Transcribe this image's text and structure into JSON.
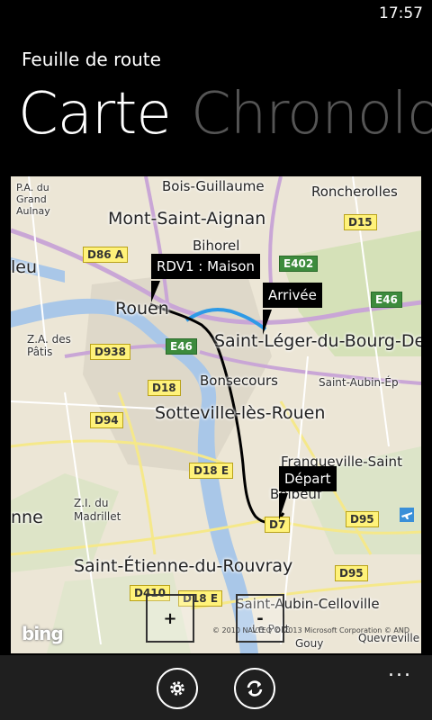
{
  "status": {
    "time": "17:57"
  },
  "app": {
    "title": "Feuille de route"
  },
  "pivot": {
    "active": "Carte",
    "next": "Chronologie"
  },
  "map": {
    "places": {
      "bois_guillaume": "Bois-Guillaume",
      "roncherolles": "Roncherolles",
      "mont_saint_aignan": "Mont-Saint-Aignan",
      "bihorel": "Bihorel",
      "rouen": "Rouen",
      "leu": "leu",
      "saint_leger": "Saint-Léger-du-Bourg-De",
      "bonsecours": "Bonsecours",
      "saint_aubin_ep": "Saint-Aubin-Ép",
      "sotteville": "Sotteville-lès-Rouen",
      "franqueville": "Franqueville-Saint",
      "belbeuf": "Belbeuf",
      "za_des_patis": "Z.A. des Pâtis",
      "zi_madrillet": "Z.I. du Madrillet",
      "saint_etienne": "Saint-Étienne-du-Rouvray",
      "saint_aubin_celloville": "Saint-Aubin-Celloville",
      "pa_du_grand_aulnay": "P.A. du Grand Aulnay",
      "quevreville": "Quevreville",
      "le_port": "Le Port",
      "gouy": "Gouy",
      "nne": "nne"
    },
    "roads": [
      "D86 A",
      "D15",
      "E402",
      "E46",
      "D938",
      "E46",
      "D18",
      "D94",
      "D18 E",
      "D7",
      "D95",
      "D95",
      "D410",
      "D18 E"
    ],
    "callouts": {
      "rdv1": "RDV1 : Maison",
      "arrivee": "Arrivée",
      "depart": "Départ"
    },
    "zoom_in": "+",
    "zoom_out": "-",
    "logo": "bing",
    "copyright": "© 2010 NAVTEQ  © 2013 Microsoft Corporation  © AND"
  },
  "appbar": {
    "more": "..."
  },
  "colors": {
    "route_black": "#000000",
    "route_blue": "#2e9ae6",
    "river": "#a9c7e8",
    "road_major": "#c9a6d6"
  }
}
